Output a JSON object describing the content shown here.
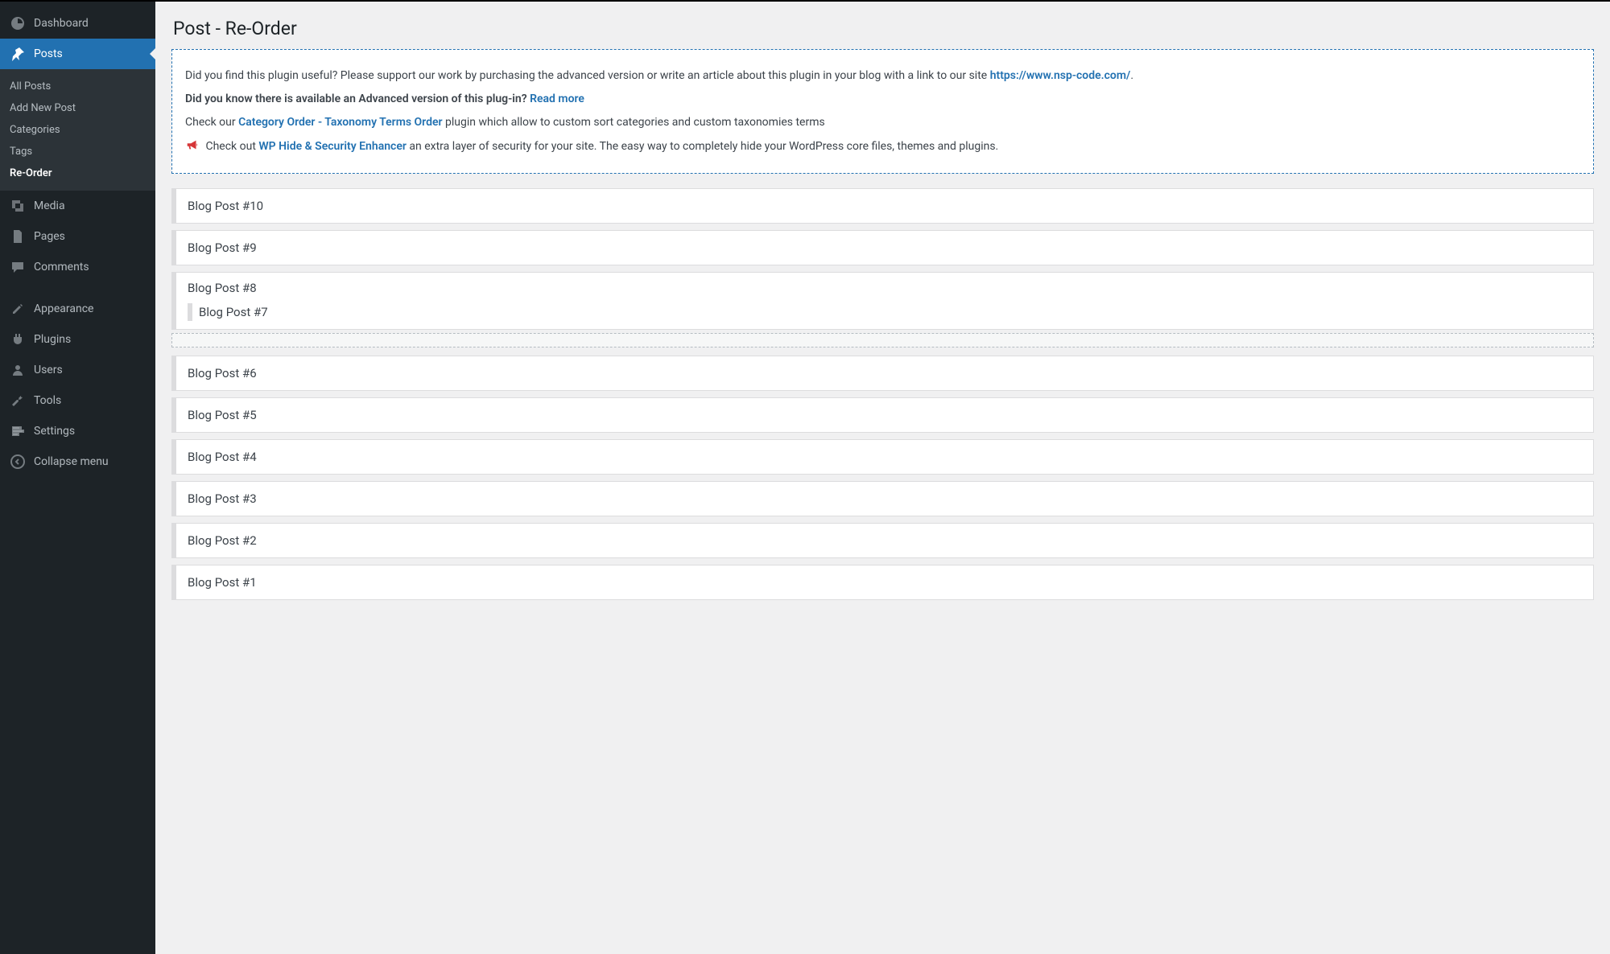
{
  "sidebar": {
    "items": [
      {
        "id": "dashboard",
        "label": "Dashboard"
      },
      {
        "id": "posts",
        "label": "Posts"
      },
      {
        "id": "media",
        "label": "Media"
      },
      {
        "id": "pages",
        "label": "Pages"
      },
      {
        "id": "comments",
        "label": "Comments"
      },
      {
        "id": "appearance",
        "label": "Appearance"
      },
      {
        "id": "plugins",
        "label": "Plugins"
      },
      {
        "id": "users",
        "label": "Users"
      },
      {
        "id": "tools",
        "label": "Tools"
      },
      {
        "id": "settings",
        "label": "Settings"
      },
      {
        "id": "collapse",
        "label": "Collapse menu"
      }
    ],
    "posts_submenu": [
      {
        "id": "all-posts",
        "label": "All Posts"
      },
      {
        "id": "add-new",
        "label": "Add New Post"
      },
      {
        "id": "categories",
        "label": "Categories"
      },
      {
        "id": "tags",
        "label": "Tags"
      },
      {
        "id": "reorder",
        "label": "Re-Order"
      }
    ]
  },
  "page": {
    "title": "Post - Re-Order"
  },
  "info": {
    "p1_a": "Did you find this plugin useful? Please support our work by purchasing the advanced version or write an article about this plugin in your blog with a link to our site ",
    "p1_link": "https://www.nsp-code.com/",
    "p1_b": ".",
    "p2_a": "Did you know there is available an Advanced version of this plug-in? ",
    "p2_link": "Read more",
    "p3_a": "Check our ",
    "p3_link": "Category Order - Taxonomy Terms Order",
    "p3_b": " plugin which allow to custom sort categories and custom taxonomies terms",
    "p4_a": "Check out ",
    "p4_link": "WP Hide & Security Enhancer",
    "p4_b": " an extra layer of security for your site. The easy way to completely hide your WordPress core files, themes and plugins."
  },
  "posts": [
    {
      "title": "Blog Post #10"
    },
    {
      "title": "Blog Post #9"
    },
    {
      "title": "Blog Post #8",
      "child": "Blog Post #7",
      "dragging": true
    },
    {
      "title": "Blog Post #6"
    },
    {
      "title": "Blog Post #5"
    },
    {
      "title": "Blog Post #4"
    },
    {
      "title": "Blog Post #3"
    },
    {
      "title": "Blog Post #2"
    },
    {
      "title": "Blog Post #1"
    }
  ]
}
